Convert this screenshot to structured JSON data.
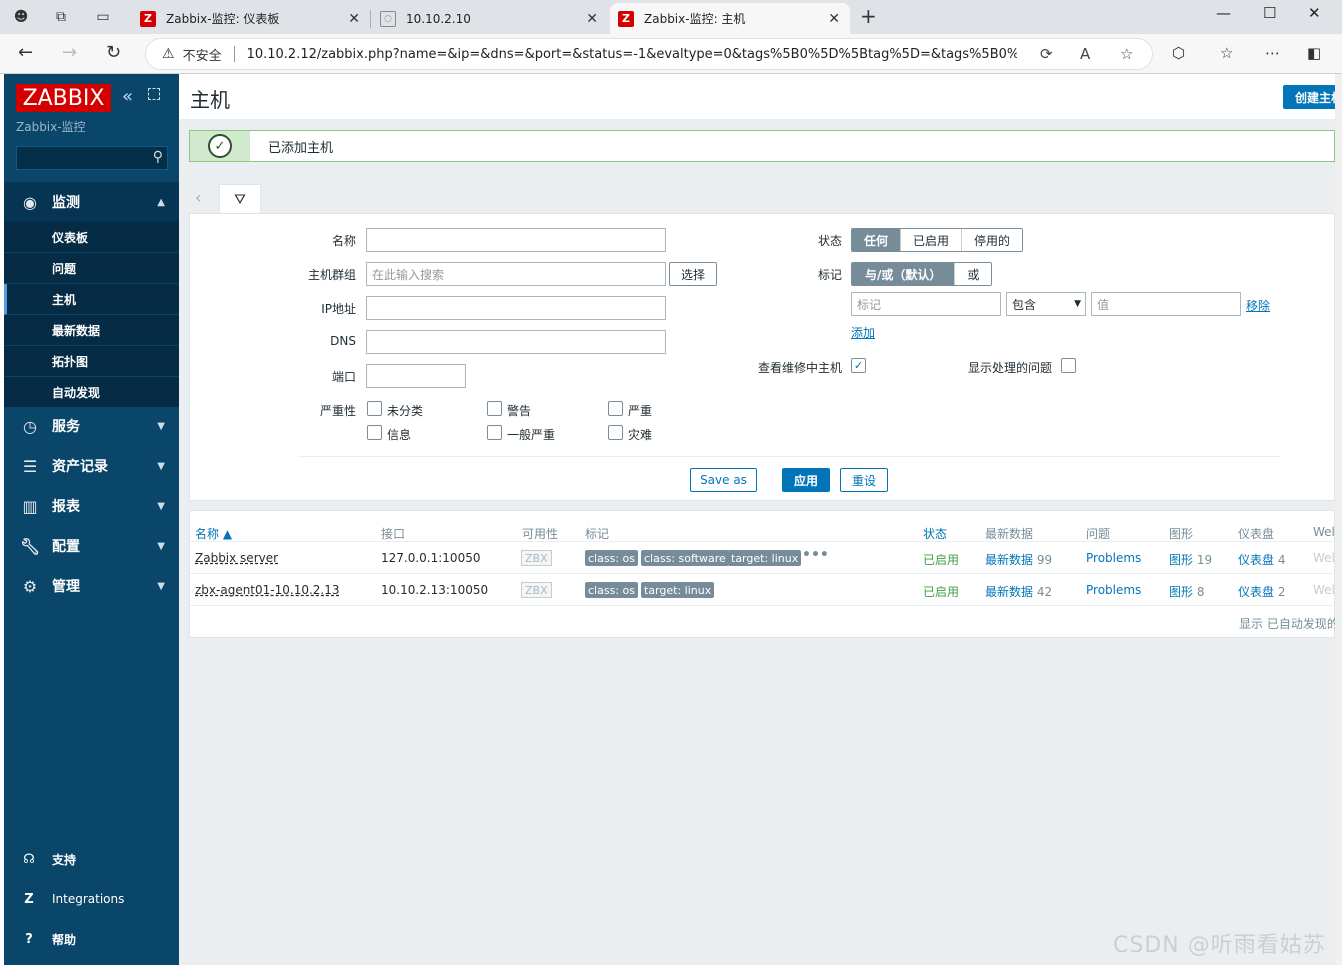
{
  "browser": {
    "tabs": [
      {
        "label": "Zabbix-监控: 仪表板",
        "active": false
      },
      {
        "label": "10.10.2.10",
        "active": false
      },
      {
        "label": "Zabbix-监控: 主机",
        "active": true
      }
    ],
    "insecure_label": "不安全",
    "url": "10.10.2.12/zabbix.php?name=&ip=&dns=&port=&status=-1&evaltype=0&tags%5B0%5D%5Btag%5D=&tags%5B0%5D..."
  },
  "sidebar": {
    "logo": "ZABBIX",
    "server_name": "Zabbix-监控",
    "search_placeholder": "",
    "sections": [
      {
        "label": "监测",
        "icon": "eye-icon",
        "open": true
      },
      {
        "label": "服务",
        "icon": "clock-icon"
      },
      {
        "label": "资产记录",
        "icon": "list-icon"
      },
      {
        "label": "报表",
        "icon": "chart-icon"
      },
      {
        "label": "配置",
        "icon": "wrench-icon"
      },
      {
        "label": "管理",
        "icon": "gear-icon"
      }
    ],
    "monitoring_items": [
      {
        "label": "仪表板"
      },
      {
        "label": "问题"
      },
      {
        "label": "主机",
        "active": true
      },
      {
        "label": "最新数据"
      },
      {
        "label": "拓扑图"
      },
      {
        "label": "自动发现"
      }
    ],
    "bottom": [
      {
        "label": "支持",
        "icon": "headset-icon"
      },
      {
        "label": "Integrations",
        "icon": "zabbix-z-icon"
      },
      {
        "label": "帮助",
        "icon": "help-icon"
      }
    ]
  },
  "page": {
    "title": "主机",
    "create_button": "创建主机"
  },
  "message": {
    "text": "已添加主机"
  },
  "filter": {
    "name_label": "名称",
    "name_value": "",
    "hostgroup_label": "主机群组",
    "hostgroup_placeholder": "在此输入搜索",
    "select_button": "选择",
    "ip_label": "IP地址",
    "dns_label": "DNS",
    "port_label": "端口",
    "severity_label": "严重性",
    "severities": [
      "未分类",
      "警告",
      "严重",
      "信息",
      "一般严重",
      "灾难"
    ],
    "status_label": "状态",
    "status_options": [
      "任何",
      "已启用",
      "停用的"
    ],
    "status_selected": "任何",
    "tags_label": "标记",
    "tags_mode_options": [
      "与/或（默认）",
      "或"
    ],
    "tag_placeholder": "标记",
    "tag_operator": "包含",
    "value_placeholder": "值",
    "remove_link": "移除",
    "add_link": "添加",
    "maintenance_label": "查看维修中主机",
    "maintenance_checked": true,
    "suppressed_label": "显示处理的问题",
    "suppressed_checked": false,
    "save_as": "Save as",
    "apply": "应用",
    "reset": "重设"
  },
  "table": {
    "headers": [
      "名称 ▲",
      "接口",
      "可用性",
      "标记",
      "状态",
      "最新数据",
      "问题",
      "图形",
      "仪表盘",
      "Wel"
    ],
    "rows": [
      {
        "name": "Zabbix server",
        "interface": "127.0.0.1:10050",
        "availability": "ZBX",
        "tags": [
          "class: os",
          "class: software",
          "target: linux"
        ],
        "status": "已启用",
        "latest_label": "最新数据",
        "latest_count": "99",
        "problems": "Problems",
        "graphs_label": "图形",
        "graphs_count": "19",
        "dash_label": "仪表盘",
        "dash_count": "4",
        "web": "Wel"
      },
      {
        "name": "zbx-agent01-10.10.2.13",
        "interface": "10.10.2.13:10050",
        "availability": "ZBX",
        "tags": [
          "class: os",
          "target: linux"
        ],
        "status": "已启用",
        "latest_label": "最新数据",
        "latest_count": "42",
        "problems": "Problems",
        "graphs_label": "图形",
        "graphs_count": "8",
        "dash_label": "仪表盘",
        "dash_count": "2",
        "web": "Wel"
      }
    ],
    "footer": "显示 已自动发现的"
  },
  "watermark": "CSDN @听雨看姑苏"
}
